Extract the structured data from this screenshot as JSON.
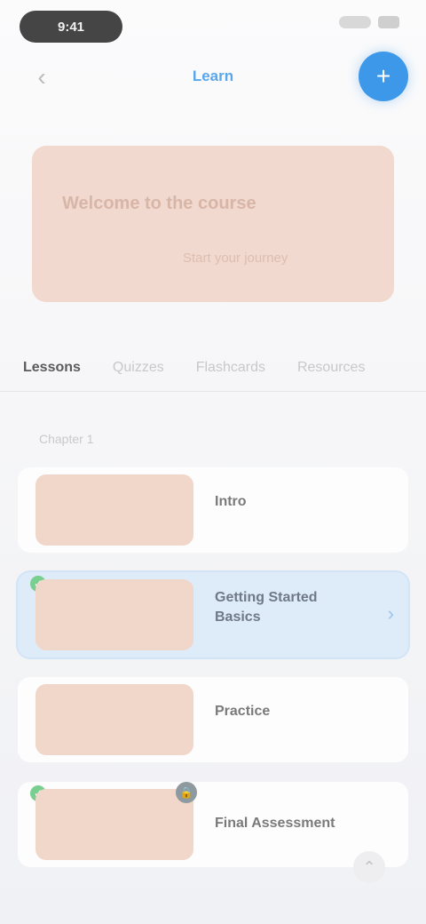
{
  "status_bar": {
    "time": "9:41"
  },
  "nav": {
    "back_icon": "chevron-left-icon",
    "title": "Learn",
    "fab_icon": "plus-icon"
  },
  "hero": {
    "title": "Welcome to the course",
    "subtitle": "Start your journey"
  },
  "tabs": [
    {
      "label": "Lessons",
      "active": true
    },
    {
      "label": "Quizzes",
      "active": false
    },
    {
      "label": "Flashcards",
      "active": false
    },
    {
      "label": "Resources",
      "active": false
    }
  ],
  "section": {
    "label": "Chapter 1"
  },
  "items": [
    {
      "title": "Intro"
    },
    {
      "title": "Getting Started Basics"
    },
    {
      "title": "Practice"
    },
    {
      "title": "Final Assessment"
    }
  ],
  "colors": {
    "accent": "#3d98ea",
    "thumb": "#f1d6ca",
    "selected_bg": "#deebf8",
    "check": "#79cf8f"
  }
}
